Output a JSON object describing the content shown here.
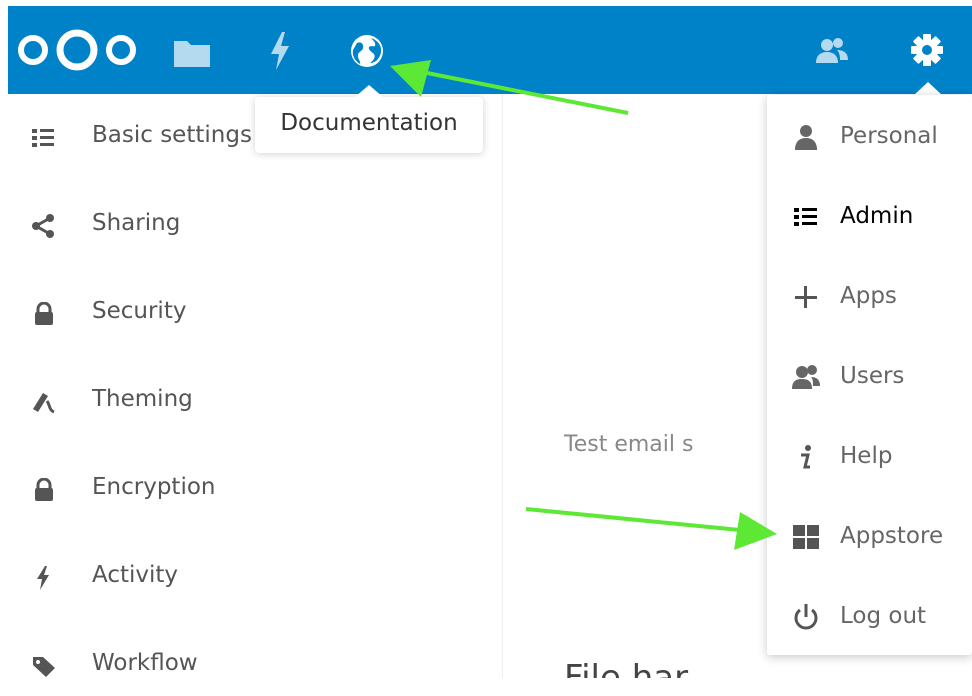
{
  "header": {
    "icons": [
      "nextcloud-logo",
      "folder-icon",
      "lightning-icon",
      "globe-icon",
      "contacts-icon",
      "gear-icon"
    ]
  },
  "tooltip": {
    "label": "Documentation"
  },
  "sidebar": {
    "items": [
      {
        "label": "Basic settings",
        "icon": "list-icon"
      },
      {
        "label": "Sharing",
        "icon": "share-icon"
      },
      {
        "label": "Security",
        "icon": "lock-icon"
      },
      {
        "label": "Theming",
        "icon": "brush-icon"
      },
      {
        "label": "Encryption",
        "icon": "lock-icon"
      },
      {
        "label": "Activity",
        "icon": "lightning-icon"
      },
      {
        "label": "Workflow",
        "icon": "tag-icon"
      }
    ]
  },
  "main": {
    "partial_text": "Test email s",
    "partial_heading": "File har"
  },
  "settings_menu": {
    "items": [
      {
        "label": "Personal",
        "icon": "person-icon"
      },
      {
        "label": "Admin",
        "icon": "list-icon",
        "active": true
      },
      {
        "label": "Apps",
        "icon": "plus-icon"
      },
      {
        "label": "Users",
        "icon": "users-icon"
      },
      {
        "label": "Help",
        "icon": "info-icon"
      },
      {
        "label": "Appstore",
        "icon": "grid-icon"
      },
      {
        "label": "Log out",
        "icon": "power-icon"
      }
    ]
  },
  "colors": {
    "header_bg": "#0082c9",
    "annotation_arrow": "#5de836",
    "icon_grey": "#555555"
  }
}
